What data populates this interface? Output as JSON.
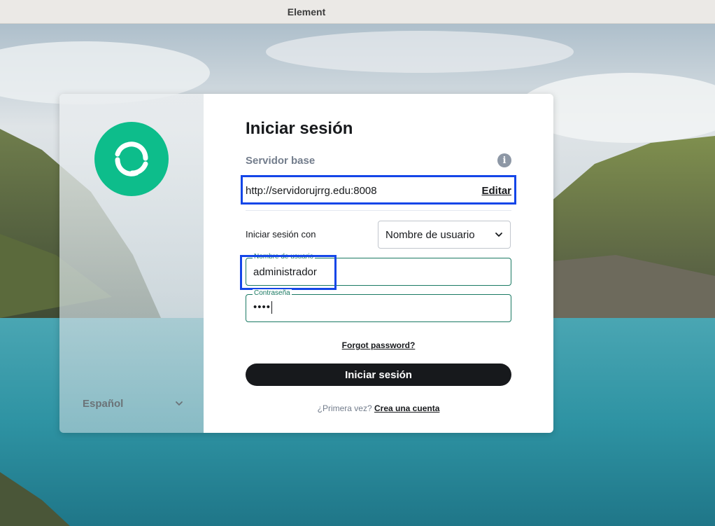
{
  "window": {
    "title": "Element"
  },
  "sidebar": {
    "language": "Español",
    "logo_icon": "element-logo-icon",
    "accent_color": "#0dbd8b"
  },
  "login": {
    "heading": "Iniciar sesión",
    "server_label": "Servidor base",
    "server_url": "http://servidorujrrg.edu:8008",
    "edit_label": "Editar",
    "login_with_label": "Iniciar sesión con",
    "login_with_value": "Nombre de usuario",
    "username_label": "Nombre de usuario",
    "username_value": "administrador",
    "password_label": "Contraseña",
    "password_masked": "••••",
    "forgot_label": "Forgot password?",
    "submit_label": "Iniciar sesión",
    "first_time_text": "¿Primera vez?",
    "create_account_label": "Crea una cuenta"
  },
  "colors": {
    "highlight": "#1446e8",
    "button_bg": "#17191c",
    "field_border": "#1a7a63"
  }
}
